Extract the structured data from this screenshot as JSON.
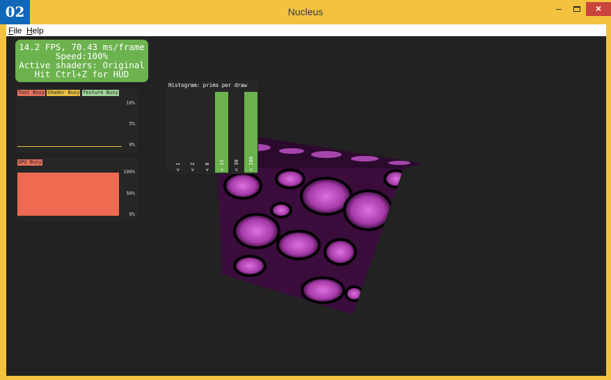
{
  "window": {
    "badge": "02",
    "title": "Nucleus",
    "minimize_glyph": "–",
    "close_glyph": "×"
  },
  "menu": {
    "file": {
      "mnemonic": "F",
      "rest": "ile"
    },
    "help": {
      "mnemonic": "H",
      "rest": "elp"
    }
  },
  "hud": {
    "line1": "14.2 FPS, 70.43 ms/frame",
    "line2": "Speed:100%",
    "line3": "Active shaders: Original",
    "line4": "Hit Ctrl+Z for HUD"
  },
  "busy_panel": {
    "tags": [
      {
        "label": "Tool Busy",
        "color": "#e3705c"
      },
      {
        "label": "Shader Busy",
        "color": "#e8c040"
      },
      {
        "label": "Texture Busy",
        "color": "#9fd49a"
      }
    ],
    "y_ticks": [
      "10%",
      "5%",
      "0%"
    ],
    "line_color": "#e8c040",
    "line_level": 0.0
  },
  "gpu_panel": {
    "tag": {
      "label": "GPU Busy",
      "color": "#e3705c"
    },
    "y_ticks": [
      "100%",
      "50%",
      "0%"
    ],
    "fill_color": "#ef6a50",
    "fill_level": 0.98
  },
  "histogram": {
    "title": "Histogram: prims per draw",
    "y_ticks": [
      "1",
      "0",
      "0"
    ],
    "categories": [
      "< 1",
      "< 2",
      "< 6",
      "< 15",
      "< 39",
      "< 100"
    ],
    "values": [
      0,
      0,
      0,
      1,
      0,
      1
    ],
    "bar_color": "#6cb24e"
  },
  "scene": {
    "object": "cube",
    "colors": {
      "base": "#3a0d3c",
      "bright": "#e070e0",
      "outline": "#050205"
    }
  }
}
